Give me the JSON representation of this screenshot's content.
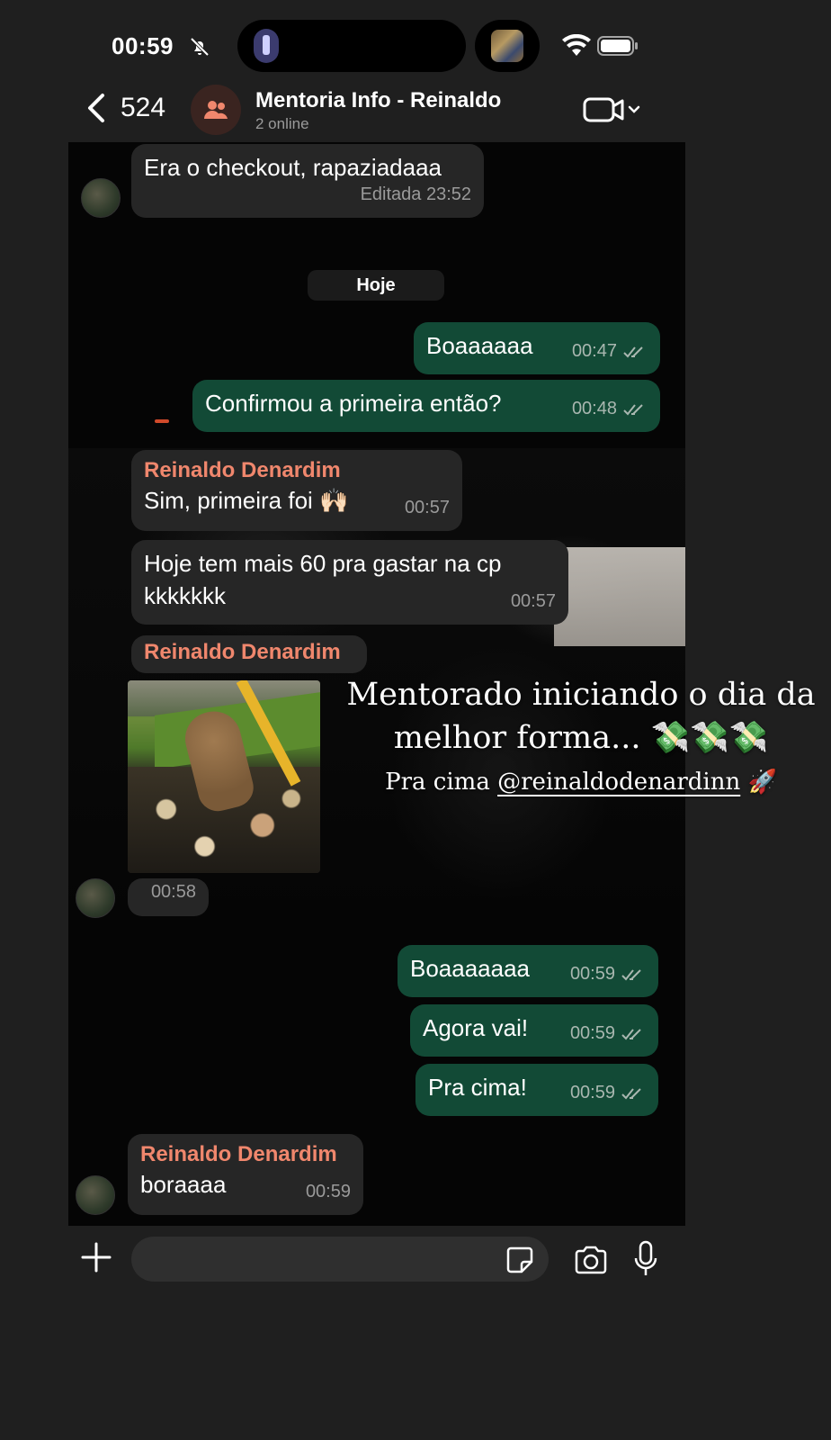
{
  "status_bar": {
    "time": "00:59"
  },
  "header": {
    "back_count": "524",
    "title": "Mentoria Info - Reinaldo",
    "subtitle": "2 online"
  },
  "messages": [
    {
      "dir": "in",
      "text": "Era o checkout, rapaziadaaa",
      "meta": "Editada 23:52"
    },
    {
      "type": "day",
      "text": "Hoje"
    },
    {
      "dir": "out",
      "text": "Boaaaaaa",
      "meta": "00:47",
      "read": true
    },
    {
      "dir": "out",
      "text": "Confirmou a primeira então?",
      "meta": "00:48",
      "read": true
    },
    {
      "dir": "in",
      "sender": "Reinaldo Denardim",
      "text": "Sim, primeira foi 🙌🏻",
      "meta": "00:57"
    },
    {
      "dir": "in",
      "text_line1": "Hoje tem mais 60 pra gastar na cp",
      "text_line2": "kkkkkkk",
      "meta": "00:57"
    },
    {
      "dir": "in",
      "sender": "Reinaldo Denardim",
      "type": "sticker",
      "meta": "00:58"
    },
    {
      "dir": "out",
      "text": "Boaaaaaaa",
      "meta": "00:59",
      "read": true
    },
    {
      "dir": "out",
      "text": "Agora vai!",
      "meta": "00:59",
      "read": true
    },
    {
      "dir": "out",
      "text": "Pra cima!",
      "meta": "00:59",
      "read": true
    },
    {
      "dir": "in",
      "sender": "Reinaldo Denardim",
      "text": "boraaaa",
      "meta": "00:59"
    }
  ],
  "caption": {
    "line1": "Mentorado iniciando o dia da",
    "line2": "melhor forma... 💸💸💸",
    "line3_prefix": "Pra cima ",
    "mention": "@reinaldodenardinn",
    "line3_suffix": " 🚀"
  },
  "icons": {
    "status": [
      "bell-off-icon",
      "flashlight-icon",
      "wifi-icon",
      "battery-icon"
    ],
    "header": [
      "back-chevron-icon",
      "group-icon",
      "video-call-icon",
      "chevron-down-icon"
    ],
    "input": [
      "plus-icon",
      "sticker-icon",
      "camera-icon",
      "microphone-icon"
    ]
  },
  "colors": {
    "incoming_bubble": "#262626",
    "outgoing_bubble": "#124a36",
    "sender_name": "#f0876d",
    "background": "#1f1f1f"
  }
}
